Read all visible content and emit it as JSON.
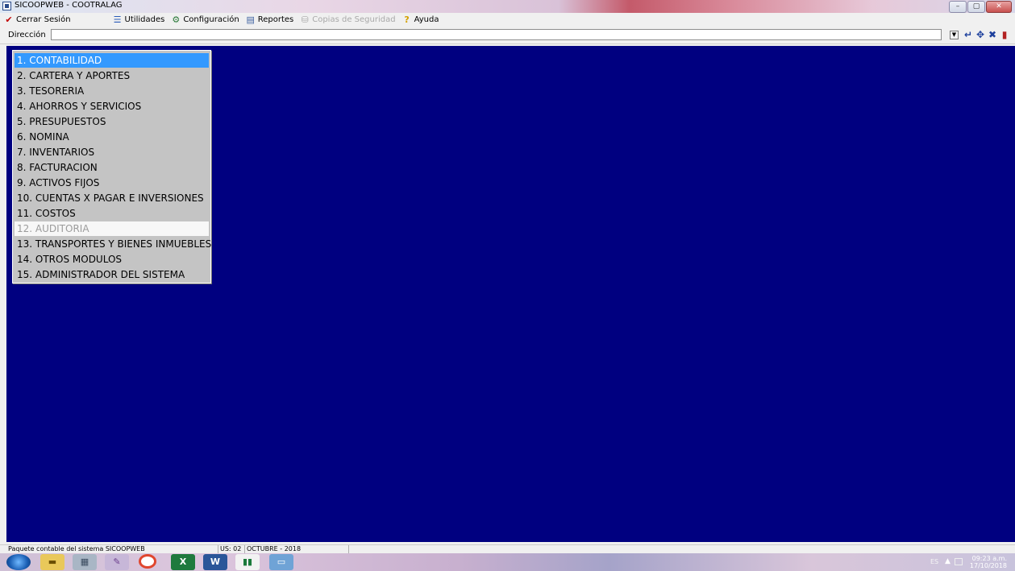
{
  "window": {
    "title": "SICOOPWEB - COOTRALAG",
    "controls": {
      "minimize": "–",
      "maximize": "▢",
      "close": "✕"
    }
  },
  "menubar": {
    "items": [
      {
        "label": "Cerrar Sesión",
        "icon": "checkmark-icon",
        "enabled": true
      },
      {
        "label": "Utilidades",
        "icon": "utilities-icon",
        "enabled": true
      },
      {
        "label": "Configuración",
        "icon": "settings-icon",
        "enabled": true
      },
      {
        "label": "Reportes",
        "icon": "reports-icon",
        "enabled": true
      },
      {
        "label": "Copias de Seguridad",
        "icon": "backup-icon",
        "enabled": false
      },
      {
        "label": "Ayuda",
        "icon": "help-icon",
        "enabled": true
      }
    ]
  },
  "address": {
    "label": "Dirección",
    "value": "",
    "tools": [
      "enter-icon",
      "move-icon",
      "cancel-icon",
      "exit-icon"
    ]
  },
  "modules": {
    "items": [
      {
        "label": "1. CONTABILIDAD",
        "state": "selected"
      },
      {
        "label": "2. CARTERA Y APORTES",
        "state": "normal"
      },
      {
        "label": "3. TESORERIA",
        "state": "normal"
      },
      {
        "label": "4. AHORROS Y SERVICIOS",
        "state": "normal"
      },
      {
        "label": "5. PRESUPUESTOS",
        "state": "normal"
      },
      {
        "label": "6. NOMINA",
        "state": "normal"
      },
      {
        "label": "7. INVENTARIOS",
        "state": "normal"
      },
      {
        "label": "8. FACTURACION",
        "state": "normal"
      },
      {
        "label": "9. ACTIVOS FIJOS",
        "state": "normal"
      },
      {
        "label": "10. CUENTAS X PAGAR E INVERSIONES",
        "state": "normal"
      },
      {
        "label": "11. COSTOS",
        "state": "normal"
      },
      {
        "label": "12. AUDITORIA",
        "state": "disabled"
      },
      {
        "label": "13. TRANSPORTES Y BIENES INMUEBLES",
        "state": "normal"
      },
      {
        "label": "14. OTROS MODULOS",
        "state": "normal"
      },
      {
        "label": "15. ADMINISTRADOR DEL SISTEMA",
        "state": "normal"
      }
    ]
  },
  "status": {
    "description": "Paquete contable del sistema SICOOPWEB",
    "user": "US: 02",
    "period": "OCTUBRE - 2018"
  },
  "taskbar": {
    "apps": [
      "start-orb-icon",
      "file-explorer-icon",
      "calculator-icon",
      "paint-icon",
      "chrome-icon",
      "excel-icon",
      "word-icon",
      "sicoopweb-icon",
      "image-viewer-icon"
    ],
    "tray": {
      "language": "ES",
      "time": "09:23 a.m.",
      "date": "17/10/2018"
    }
  },
  "colors": {
    "workspace": "#000080",
    "menu_bg": "#c4c4c4",
    "selected": "#3399ff",
    "disabled_text": "#9c9c9c"
  }
}
